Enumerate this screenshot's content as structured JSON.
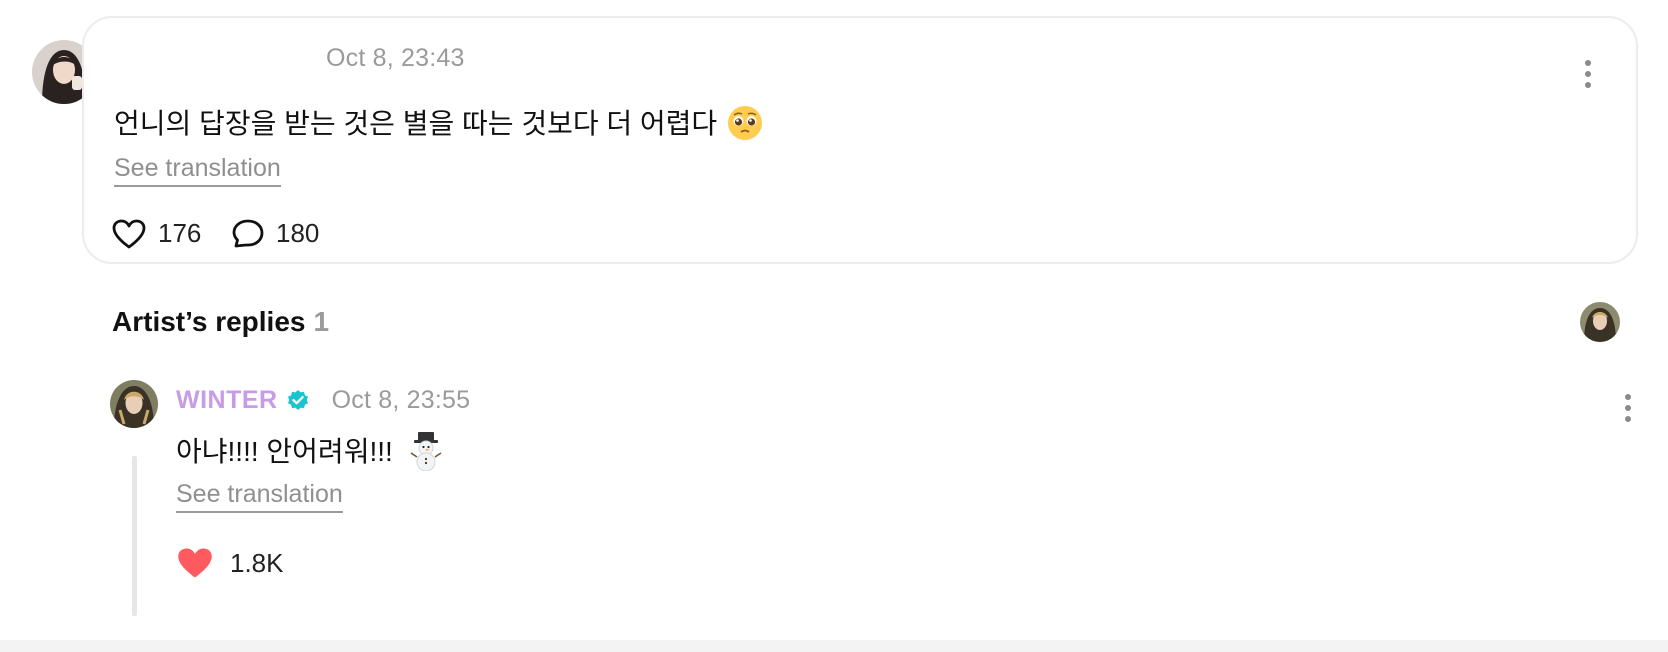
{
  "main_comment": {
    "timestamp": "Oct 8, 23:43",
    "text": "언니의 답장을 받는 것은 별을 따는 것보다 더 어렵다",
    "emoji": "pleading-face",
    "see_translation": "See translation",
    "likes": "176",
    "comments": "180"
  },
  "artist_replies": {
    "heading": "Artist’s replies",
    "count": "1",
    "reply": {
      "artist_name": "WINTER",
      "timestamp": "Oct 8, 23:55",
      "text": "아냐!!!! 안어려워!!!",
      "emoji": "snowman",
      "see_translation": "See translation",
      "likes": "1.8K"
    }
  },
  "colors": {
    "artist_name": "#c79be6",
    "verified_badge": "#19c3cf",
    "liked_heart": "#ff5a5f"
  }
}
